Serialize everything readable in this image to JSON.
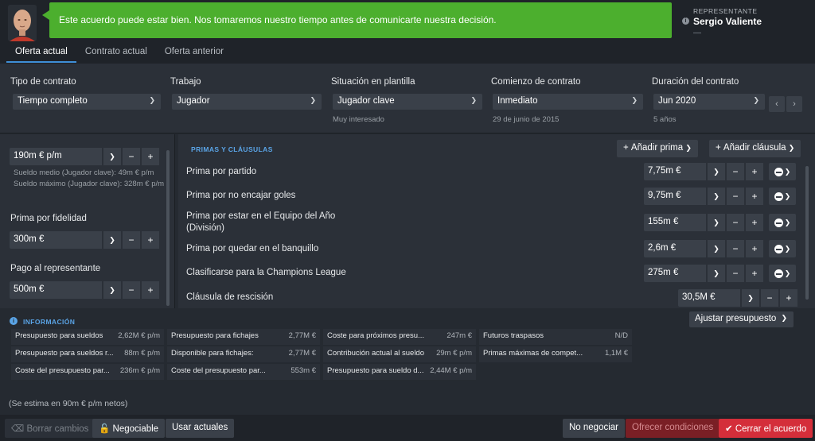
{
  "header": {
    "message": "Este acuerdo puede estar bien. Nos tomaremos nuestro tiempo antes de comunicarte nuestra decisión.",
    "rep_label": "REPRESENTANTE",
    "rep_name": "Sergio Valiente",
    "rep_sub": "—",
    "message_color": "#4caf2e"
  },
  "tabs": [
    "Oferta actual",
    "Contrato actual",
    "Oferta anterior"
  ],
  "contract": {
    "tipo": {
      "label": "Tipo de contrato",
      "value": "Tiempo completo"
    },
    "trabajo": {
      "label": "Trabajo",
      "value": "Jugador"
    },
    "situacion": {
      "label": "Situación en plantilla",
      "value": "Jugador clave",
      "sub": "Muy interesado"
    },
    "comienzo": {
      "label": "Comienzo de contrato",
      "value": "Inmediato",
      "sub": "29 de junio de 2015"
    },
    "duracion": {
      "label": "Duración del contrato",
      "value": "Jun 2020",
      "sub": "5 años"
    }
  },
  "left": {
    "sueldo_value": "190m € p/m",
    "sueldo_medio": "Sueldo medio (Jugador clave): 49m € p/m",
    "sueldo_maximo": "Sueldo máximo (Jugador clave): 328m € p/m",
    "fidelidad_label": "Prima por fidelidad",
    "fidelidad_value": "300m €",
    "representante_label": "Pago al representante",
    "representante_value": "500m €"
  },
  "bonuses": {
    "title": "PRIMAS Y CLÁUSULAS",
    "add_bonus": "Añadir prima",
    "add_clause": "Añadir cláusula",
    "rows": [
      {
        "label": "Prima por partido",
        "value": "7,75m €"
      },
      {
        "label": "Prima por no encajar goles",
        "value": "9,75m €"
      },
      {
        "label": "Prima por estar en el Equipo del Año (División)",
        "value": "155m €"
      },
      {
        "label": "Prima por quedar en el banquillo",
        "value": "2,6m €"
      },
      {
        "label": "Clasificarse para la Champions League",
        "value": "275m €"
      }
    ],
    "clause": {
      "label": "Cláusula de rescisión",
      "value": "30,5M €"
    }
  },
  "info": {
    "title": "INFORMACIÓN",
    "adjust": "Ajustar presupuesto",
    "cells": [
      {
        "k": "Presupuesto para sueldos",
        "v": "2,62M € p/m"
      },
      {
        "k": "Presupuesto para sueldos r...",
        "v": "88m € p/m"
      },
      {
        "k": "Coste del presupuesto par...",
        "v": "236m € p/m"
      },
      {
        "k": "Presupuesto para fichajes",
        "v": "2,77M €"
      },
      {
        "k": "Disponible para fichajes:",
        "v": "2,77M €"
      },
      {
        "k": "Coste del presupuesto par...",
        "v": "553m €"
      },
      {
        "k": "Coste para próximos presu...",
        "v": "247m €"
      },
      {
        "k": "Contribución actual al sueldo",
        "v": "29m € p/m"
      },
      {
        "k": "Presupuesto para sueldo d...",
        "v": "2,44M € p/m"
      },
      {
        "k": "Futuros traspasos",
        "v": "N/D"
      },
      {
        "k": "Primas máximas de compet...",
        "v": "1,1M €"
      }
    ]
  },
  "estimate": "(Se estima en 90m € p/m netos)",
  "footer": {
    "borrar": "Borrar cambios",
    "negociable": "Negociable",
    "usar": "Usar actuales",
    "no_negociar": "No negociar",
    "ofrecer": "Ofrecer condiciones",
    "cerrar": "Cerrar el acuerdo"
  }
}
